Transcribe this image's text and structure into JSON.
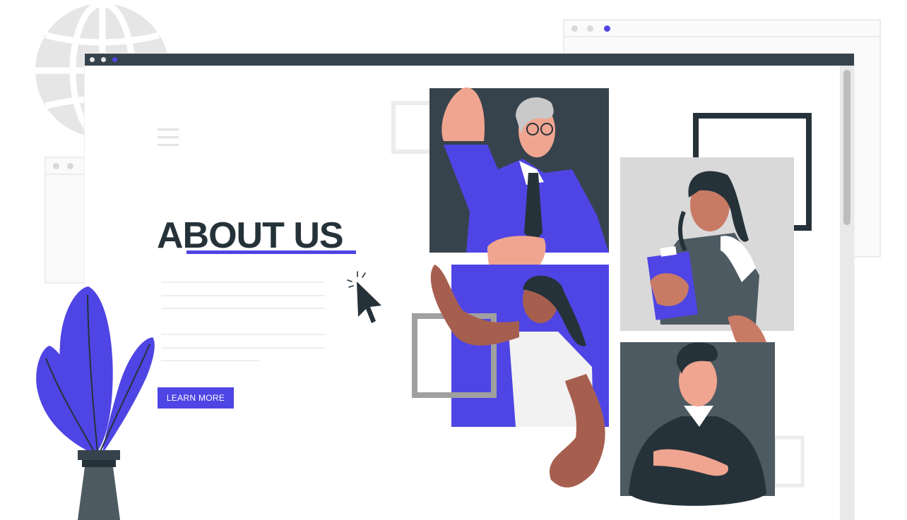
{
  "page": {
    "headline": "ABOUT US",
    "cta_label": "LEARN MORE"
  },
  "colors": {
    "accent": "#4f45e4",
    "dark": "#37434c",
    "text": "#26323a",
    "skin_light": "#f0a591",
    "skin_dark": "#a65f4f"
  },
  "icons": {
    "menu": "hamburger-icon",
    "cursor": "mouse-pointer-icon",
    "globe": "globe-icon",
    "plant": "potted-plant"
  }
}
